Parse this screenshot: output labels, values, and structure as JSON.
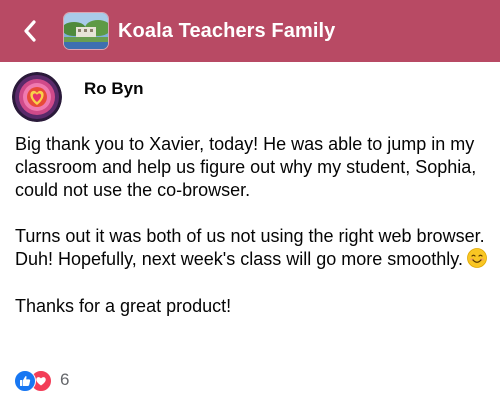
{
  "header": {
    "group_name": "Koala Teachers Family",
    "back_icon": "chevron-left-icon",
    "background_color": "#b84a64"
  },
  "post": {
    "author": "Ro Byn",
    "paragraphs": [
      "Big thank you to Xavier, today! He was able to jump in my classroom and help us figure out why my student, Sophia, could not use the co-browser.",
      "Turns out it was both of us not using the right web browser. Duh! Hopefully, next week's class will go more smoothly.",
      "Thanks for a great product!"
    ],
    "emoji": "smiling-face-icon",
    "reactions": {
      "icons": [
        "like-icon",
        "heart-icon"
      ],
      "count": "6"
    }
  }
}
